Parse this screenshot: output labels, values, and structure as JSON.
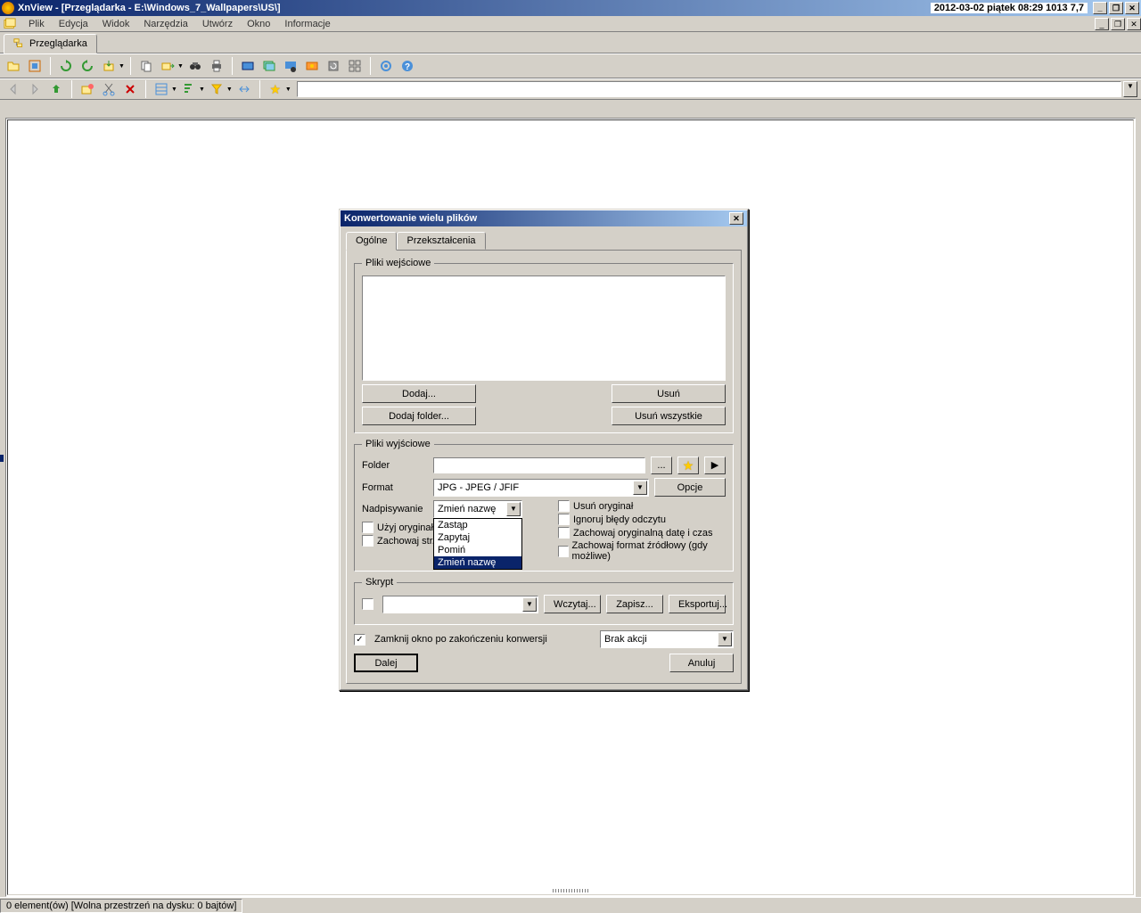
{
  "title": "XnView - [Przeglądarka - E:\\Windows_7_Wallpapers\\US\\]",
  "titlebar_info": "2012-03-02 piątek 08:29  1013  7,7",
  "menu": [
    "Plik",
    "Edycja",
    "Widok",
    "Narzędzia",
    "Utwórz",
    "Okno",
    "Informacje"
  ],
  "tab": "Przeglądarka",
  "dialog": {
    "title": "Konwertowanie wielu plików",
    "tabs": [
      "Ogólne",
      "Przekształcenia"
    ],
    "group_input": "Pliki wejściowe",
    "btn_add": "Dodaj...",
    "btn_add_folder": "Dodaj folder...",
    "btn_remove": "Usuń",
    "btn_remove_all": "Usuń wszystkie",
    "group_output": "Pliki wyjściowe",
    "lbl_folder": "Folder",
    "lbl_format": "Format",
    "format_value": "JPG - JPEG / JFIF",
    "btn_options": "Opcje",
    "lbl_overwrite": "Nadpisywanie",
    "overwrite_value": "Zmień nazwę",
    "dropdown_options": [
      "Zastąp",
      "Zapytaj",
      "Pomiń",
      "Zmień nazwę"
    ],
    "chk_use_original": "Użyj oryginał...)",
    "chk_keep_struct": "Zachowaj str...",
    "chk_delete_orig": "Usuń oryginał",
    "chk_ignore_errors": "Ignoruj błędy odczytu",
    "chk_keep_date": "Zachowaj oryginalną datę i czas",
    "chk_keep_format": "Zachowaj format źródłowy (gdy możliwe)",
    "group_script": "Skrypt",
    "btn_load": "Wczytaj...",
    "btn_save": "Zapisz...",
    "btn_export": "Eksportuj...",
    "chk_close_after": "Zamknij okno po zakończeniu konwersji",
    "action_value": "Brak akcji",
    "btn_go": "Dalej",
    "btn_cancel": "Anuluj"
  },
  "status": "0 element(ów) [Wolna przestrzeń na dysku: 0 bajtów]"
}
